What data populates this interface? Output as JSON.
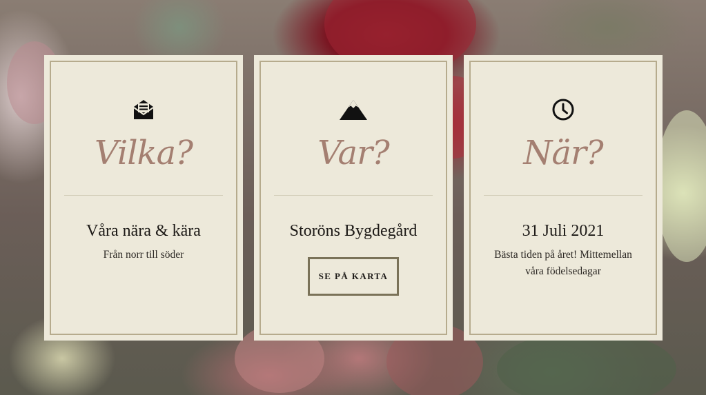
{
  "cards": [
    {
      "icon": "envelope-open-icon",
      "heading": "Vilka?",
      "title": "Våra nära & kära",
      "subtitle": "Från norr till söder"
    },
    {
      "icon": "mountain-icon",
      "heading": "Var?",
      "title": "Storöns Bygdegård",
      "button_label": "SE PÅ KARTA"
    },
    {
      "icon": "clock-icon",
      "heading": "När?",
      "title": "31 Juli 2021",
      "subtitle": "Bästa tiden på året! Mittemellan våra födelsedagar"
    }
  ],
  "colors": {
    "card_background": "#ede9da",
    "card_border": "#b6ab8d",
    "heading": "#a47f71",
    "text": "#1d1a17",
    "button_border": "#7a7258"
  }
}
